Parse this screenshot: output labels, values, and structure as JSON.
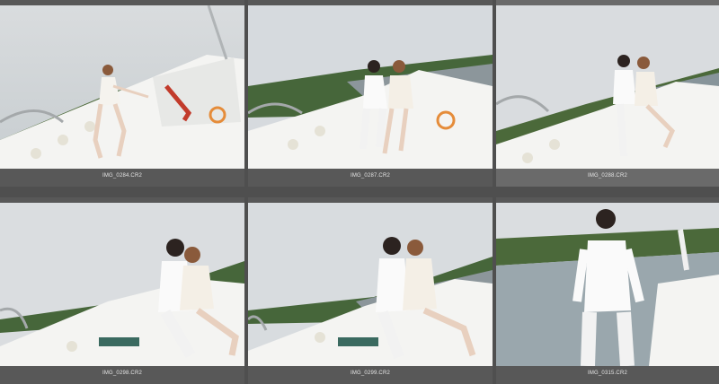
{
  "grid": {
    "thumbnails": [
      {
        "filename": "IMG_0284.CR2",
        "selected": false
      },
      {
        "filename": "IMG_0287.CR2",
        "selected": false
      },
      {
        "filename": "IMG_0288.CR2",
        "selected": true
      },
      {
        "filename": "IMG_0298.CR2",
        "selected": false
      },
      {
        "filename": "IMG_0299.CR2",
        "selected": false
      },
      {
        "filename": "IMG_0315.CR2",
        "selected": false
      }
    ]
  },
  "colors": {
    "background": "#4f4f4f",
    "cell": "#585858",
    "cell_selected": "#6a6a6a",
    "caption_text": "#e6e6e6"
  }
}
